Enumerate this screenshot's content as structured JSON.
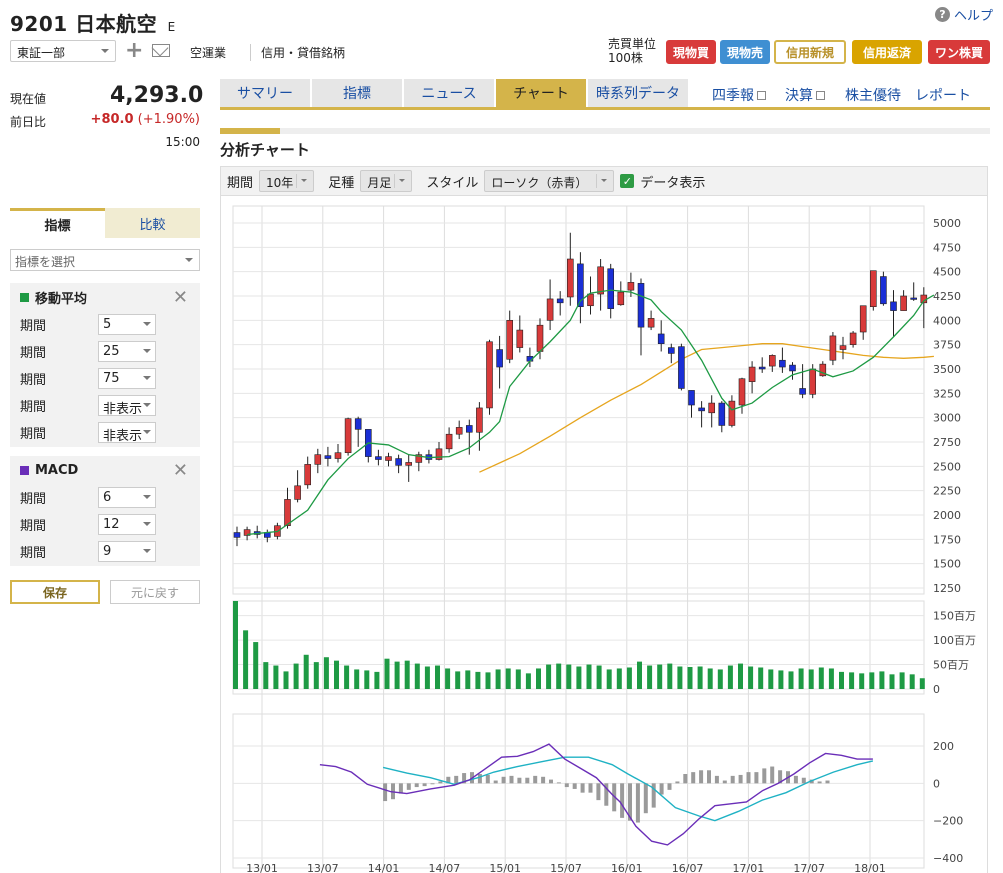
{
  "header": {
    "code": "9201",
    "name": "日本航空",
    "badge": "E",
    "help": "ヘルプ",
    "market": "東証一部",
    "sector": "空運業",
    "credit": "信用・貸借銘柄",
    "unit_label": "売買単位",
    "unit_value": "100株"
  },
  "trade_buttons": [
    {
      "label": "現物買",
      "bg": "#d83a3a",
      "fg": "#ffffff",
      "border": "#d83a3a"
    },
    {
      "label": "現物売",
      "bg": "#3f8fd2",
      "fg": "#ffffff",
      "border": "#3f8fd2"
    },
    {
      "label": "信用新規",
      "bg": "#ffffff",
      "fg": "#b8912a",
      "border": "#d4b44a"
    },
    {
      "label": "信用返済",
      "bg": "#d9a400",
      "fg": "#ffffff",
      "border": "#d9a400"
    },
    {
      "label": "ワン株買",
      "bg": "#d83a3a",
      "fg": "#ffffff",
      "border": "#d83a3a"
    }
  ],
  "quote": {
    "current_label": "現在値",
    "current_value": "4,293.0",
    "prev_label": "前日比",
    "change": "+80.0",
    "change_pct": "(+1.90%)",
    "time": "15:00"
  },
  "left_tabs": {
    "indicator": "指標",
    "compare": "比較"
  },
  "indicator_select": "指標を選択",
  "ma_panel": {
    "title": "移動平均",
    "color": "#1e9a44",
    "rows": [
      {
        "label": "期間",
        "value": "5"
      },
      {
        "label": "期間",
        "value": "25"
      },
      {
        "label": "期間",
        "value": "75"
      },
      {
        "label": "期間",
        "value": "非表示"
      },
      {
        "label": "期間",
        "value": "非表示"
      }
    ]
  },
  "macd_panel": {
    "title": "MACD",
    "color": "#6a2eb8",
    "rows": [
      {
        "label": "期間",
        "value": "6"
      },
      {
        "label": "期間",
        "value": "12"
      },
      {
        "label": "期間",
        "value": "9"
      }
    ]
  },
  "save": "保存",
  "revert": "元に戻す",
  "tabs": [
    "サマリー",
    "指標",
    "ニュース",
    "チャート",
    "時系列データ"
  ],
  "links": [
    {
      "label": "四季報",
      "ext": true
    },
    {
      "label": "決算",
      "ext": true
    },
    {
      "label": "株主優待",
      "ext": false
    },
    {
      "label": "レポート",
      "ext": false
    }
  ],
  "section_title": "分析チャート",
  "controls": {
    "period_label": "期間",
    "period_value": "10年",
    "bar_label": "足種",
    "bar_value": "月足",
    "style_label": "スタイル",
    "style_value": "ローソク（赤青）",
    "data_label": "データ表示"
  },
  "chart_data": {
    "type": "candlestick",
    "x_ticks": [
      "13/01",
      "13/07",
      "14/01",
      "14/07",
      "15/01",
      "15/07",
      "16/01",
      "16/07",
      "17/01",
      "17/07",
      "18/01"
    ],
    "price_axis": {
      "ticks": [
        5000,
        4750,
        4500,
        4250,
        4000,
        3750,
        3500,
        3250,
        3000,
        2750,
        2500,
        2250,
        2000,
        1750,
        1500,
        1250
      ],
      "range": [
        1250,
        5000
      ]
    },
    "volume_axis": {
      "ticks": [
        "150百万",
        "100百万",
        "50百万",
        "0"
      ],
      "max": 180
    },
    "macd_axis": {
      "ticks": [
        "200",
        "0",
        "−200",
        "−400"
      ],
      "range": [
        -400,
        200
      ]
    },
    "colors": {
      "up": "#d83a3a",
      "down": "#1a2fd6",
      "ma_short": "#1e9a44",
      "ma_long": "#e6a51e",
      "volume": "#1e9a44",
      "macd": "#6a2eb8",
      "signal": "#1fb2c4",
      "histogram": "#9a9a9a"
    },
    "candles": [
      [
        1820,
        1770,
        1880,
        1680
      ],
      [
        1790,
        1850,
        1880,
        1740
      ],
      [
        1830,
        1800,
        1890,
        1760
      ],
      [
        1820,
        1770,
        1850,
        1720
      ],
      [
        1780,
        1890,
        1920,
        1750
      ],
      [
        1890,
        2160,
        2280,
        1860
      ],
      [
        2160,
        2300,
        2460,
        2130
      ],
      [
        2310,
        2520,
        2600,
        2270
      ],
      [
        2520,
        2620,
        2680,
        2430
      ],
      [
        2610,
        2580,
        2700,
        2500
      ],
      [
        2580,
        2640,
        2730,
        2540
      ],
      [
        2640,
        2990,
        3000,
        2610
      ],
      [
        2990,
        2880,
        3010,
        2700
      ],
      [
        2880,
        2600,
        2720,
        2540
      ],
      [
        2600,
        2570,
        2670,
        2510
      ],
      [
        2560,
        2600,
        2640,
        2500
      ],
      [
        2580,
        2510,
        2620,
        2430
      ],
      [
        2510,
        2540,
        2620,
        2340
      ],
      [
        2540,
        2620,
        2650,
        2450
      ],
      [
        2620,
        2570,
        2670,
        2530
      ],
      [
        2570,
        2680,
        2750,
        2560
      ],
      [
        2680,
        2830,
        2900,
        2640
      ],
      [
        2830,
        2900,
        2970,
        2780
      ],
      [
        2920,
        2850,
        2980,
        2620
      ],
      [
        2850,
        3100,
        3160,
        2660
      ],
      [
        3100,
        3780,
        3800,
        3030
      ],
      [
        3700,
        3520,
        3840,
        3300
      ],
      [
        3600,
        4000,
        4100,
        3560
      ],
      [
        3720,
        3900,
        4050,
        3670
      ],
      [
        3630,
        3580,
        3720,
        3520
      ],
      [
        3680,
        3950,
        4020,
        3600
      ],
      [
        4000,
        4220,
        4420,
        3900
      ],
      [
        4220,
        4180,
        4300,
        4050
      ],
      [
        4240,
        4630,
        4900,
        4150
      ],
      [
        4580,
        4140,
        4700,
        3970
      ],
      [
        4150,
        4270,
        4450,
        4060
      ],
      [
        4270,
        4550,
        4630,
        4100
      ],
      [
        4530,
        4120,
        4580,
        4020
      ],
      [
        4160,
        4290,
        4400,
        4150
      ],
      [
        4310,
        4390,
        4490,
        4240
      ],
      [
        4380,
        3930,
        4430,
        3640
      ],
      [
        3930,
        4020,
        4100,
        3900
      ],
      [
        3860,
        3760,
        4000,
        3680
      ],
      [
        3720,
        3660,
        3760,
        3560
      ],
      [
        3730,
        3300,
        3760,
        3280
      ],
      [
        3280,
        3130,
        3280,
        3000
      ],
      [
        3100,
        3070,
        3170,
        2900
      ],
      [
        3050,
        3150,
        3230,
        2900
      ],
      [
        3150,
        2920,
        3170,
        2850
      ],
      [
        2920,
        3170,
        3230,
        2900
      ],
      [
        3130,
        3400,
        3410,
        3040
      ],
      [
        3370,
        3520,
        3580,
        3250
      ],
      [
        3520,
        3500,
        3620,
        3460
      ],
      [
        3530,
        3640,
        3650,
        3470
      ],
      [
        3590,
        3520,
        3720,
        3460
      ],
      [
        3540,
        3480,
        3570,
        3390
      ],
      [
        3300,
        3240,
        3550,
        3200
      ],
      [
        3240,
        3500,
        3550,
        3200
      ],
      [
        3430,
        3550,
        3580,
        3420
      ],
      [
        3590,
        3840,
        3880,
        3540
      ],
      [
        3700,
        3740,
        3830,
        3600
      ],
      [
        3750,
        3870,
        3890,
        3720
      ],
      [
        3880,
        4150,
        4150,
        3800
      ],
      [
        4140,
        4510,
        4510,
        4100
      ],
      [
        4450,
        4170,
        4500,
        4150
      ],
      [
        4190,
        4100,
        4310,
        3830
      ],
      [
        4100,
        4250,
        4310,
        4100
      ],
      [
        4230,
        4220,
        4390,
        4200
      ],
      [
        4180,
        4260,
        4340,
        3920
      ]
    ],
    "ma_short": [
      [
        1,
        1800
      ],
      [
        4,
        1830
      ],
      [
        7,
        2050
      ],
      [
        9,
        2360
      ],
      [
        11,
        2580
      ],
      [
        13,
        2740
      ],
      [
        15,
        2720
      ],
      [
        17,
        2620
      ],
      [
        19,
        2590
      ],
      [
        21,
        2600
      ],
      [
        23,
        2690
      ],
      [
        25,
        2850
      ],
      [
        26,
        2960
      ],
      [
        27,
        3320
      ],
      [
        29,
        3580
      ],
      [
        31,
        3780
      ],
      [
        33,
        4000
      ],
      [
        34,
        4200
      ],
      [
        35,
        4280
      ],
      [
        37,
        4310
      ],
      [
        39,
        4290
      ],
      [
        41,
        4210
      ],
      [
        42,
        4090
      ],
      [
        44,
        3900
      ],
      [
        46,
        3590
      ],
      [
        48,
        3200
      ],
      [
        49,
        3080
      ],
      [
        51,
        3150
      ],
      [
        53,
        3310
      ],
      [
        55,
        3440
      ],
      [
        57,
        3500
      ],
      [
        59,
        3420
      ],
      [
        61,
        3480
      ],
      [
        63,
        3620
      ],
      [
        65,
        3830
      ],
      [
        67,
        4050
      ],
      [
        68,
        4200
      ],
      [
        69,
        4260
      ]
    ],
    "ma_long": [
      [
        24,
        2440
      ],
      [
        28,
        2630
      ],
      [
        31,
        2810
      ],
      [
        34,
        3000
      ],
      [
        37,
        3180
      ],
      [
        40,
        3340
      ],
      [
        42,
        3470
      ],
      [
        44,
        3600
      ],
      [
        46,
        3700
      ],
      [
        48,
        3720
      ],
      [
        50,
        3740
      ],
      [
        52,
        3760
      ],
      [
        54,
        3760
      ],
      [
        56,
        3730
      ],
      [
        58,
        3700
      ],
      [
        60,
        3670
      ],
      [
        62,
        3640
      ],
      [
        64,
        3620
      ],
      [
        66,
        3610
      ],
      [
        68,
        3620
      ],
      [
        69,
        3630
      ]
    ],
    "volume": [
      180,
      120,
      96,
      55,
      48,
      36,
      52,
      70,
      55,
      65,
      58,
      48,
      40,
      38,
      35,
      62,
      56,
      58,
      52,
      46,
      48,
      42,
      36,
      38,
      35,
      34,
      40,
      42,
      40,
      32,
      42,
      50,
      52,
      50,
      46,
      50,
      48,
      40,
      42,
      44,
      56,
      48,
      50,
      52,
      46,
      45,
      46,
      42,
      40,
      48,
      52,
      46,
      44,
      40,
      38,
      36,
      42,
      40,
      44,
      42,
      35,
      34,
      32,
      34,
      36,
      30,
      34,
      30,
      22
    ],
    "macd": [
      [
        11,
        100
      ],
      [
        13,
        90
      ],
      [
        15,
        60
      ],
      [
        17,
        -5
      ],
      [
        20,
        -45
      ],
      [
        22,
        -55
      ],
      [
        25,
        -30
      ],
      [
        28,
        -10
      ],
      [
        30,
        20
      ],
      [
        32,
        80
      ],
      [
        34,
        140
      ],
      [
        36,
        145
      ],
      [
        38,
        170
      ],
      [
        40,
        210
      ],
      [
        42,
        130
      ],
      [
        44,
        80
      ],
      [
        46,
        30
      ],
      [
        48,
        -60
      ],
      [
        49,
        -100
      ],
      [
        51,
        -230
      ],
      [
        53,
        -310
      ],
      [
        55,
        -330
      ],
      [
        57,
        -270
      ],
      [
        59,
        -190
      ],
      [
        61,
        -120
      ],
      [
        63,
        -110
      ],
      [
        65,
        -100
      ],
      [
        67,
        -40
      ],
      [
        69,
        0
      ],
      [
        71,
        50
      ],
      [
        73,
        110
      ],
      [
        75,
        160
      ],
      [
        77,
        150
      ],
      [
        79,
        130
      ],
      [
        81,
        130
      ]
    ],
    "signal": [
      [
        19,
        85
      ],
      [
        22,
        55
      ],
      [
        25,
        30
      ],
      [
        28,
        -5
      ],
      [
        31,
        30
      ],
      [
        33,
        60
      ],
      [
        36,
        90
      ],
      [
        39,
        115
      ],
      [
        42,
        140
      ],
      [
        45,
        140
      ],
      [
        48,
        100
      ],
      [
        50,
        50
      ],
      [
        53,
        -20
      ],
      [
        56,
        -130
      ],
      [
        59,
        -175
      ],
      [
        61,
        -200
      ],
      [
        64,
        -150
      ],
      [
        67,
        -90
      ],
      [
        70,
        -50
      ],
      [
        73,
        10
      ],
      [
        76,
        60
      ],
      [
        79,
        100
      ],
      [
        81,
        120
      ]
    ],
    "histogram": [
      [
        19,
        -95
      ],
      [
        20,
        -85
      ],
      [
        21,
        -55
      ],
      [
        22,
        -35
      ],
      [
        23,
        -20
      ],
      [
        24,
        -15
      ],
      [
        25,
        -5
      ],
      [
        26,
        10
      ],
      [
        27,
        35
      ],
      [
        28,
        40
      ],
      [
        29,
        55
      ],
      [
        30,
        60
      ],
      [
        31,
        50
      ],
      [
        32,
        45
      ],
      [
        33,
        15
      ],
      [
        34,
        35
      ],
      [
        35,
        40
      ],
      [
        36,
        30
      ],
      [
        37,
        30
      ],
      [
        38,
        40
      ],
      [
        39,
        35
      ],
      [
        40,
        20
      ],
      [
        41,
        5
      ],
      [
        42,
        -20
      ],
      [
        43,
        -30
      ],
      [
        44,
        -50
      ],
      [
        45,
        -50
      ],
      [
        46,
        -90
      ],
      [
        47,
        -120
      ],
      [
        48,
        -150
      ],
      [
        49,
        -185
      ],
      [
        50,
        -200
      ],
      [
        51,
        -210
      ],
      [
        52,
        -160
      ],
      [
        53,
        -130
      ],
      [
        54,
        -60
      ],
      [
        55,
        -35
      ],
      [
        56,
        10
      ],
      [
        57,
        50
      ],
      [
        58,
        60
      ],
      [
        59,
        70
      ],
      [
        60,
        70
      ],
      [
        61,
        40
      ],
      [
        62,
        15
      ],
      [
        63,
        40
      ],
      [
        64,
        45
      ],
      [
        65,
        60
      ],
      [
        66,
        60
      ],
      [
        67,
        80
      ],
      [
        68,
        90
      ],
      [
        69,
        70
      ],
      [
        70,
        65
      ],
      [
        71,
        40
      ],
      [
        72,
        30
      ],
      [
        73,
        20
      ],
      [
        74,
        10
      ],
      [
        75,
        15
      ]
    ]
  }
}
